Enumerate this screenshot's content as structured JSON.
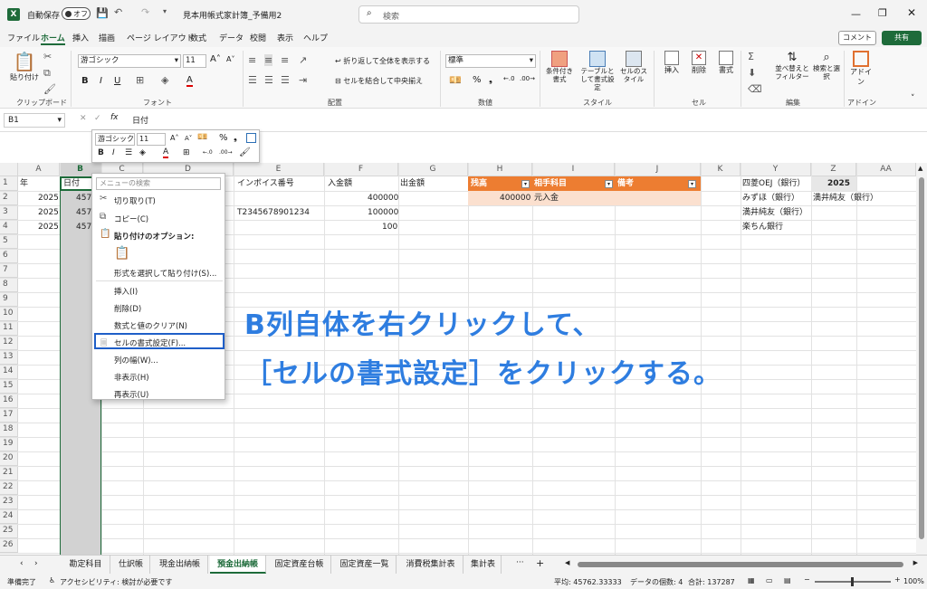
{
  "titlebar": {
    "autosave": "自動保存",
    "toggle": "オフ",
    "filename": "見本用帳式家計簿_予備用2",
    "search_placeholder": "検索"
  },
  "menu": [
    "ファイル",
    "ホーム",
    "挿入",
    "描画",
    "ページ レイアウト",
    "数式",
    "データ",
    "校閲",
    "表示",
    "ヘルプ"
  ],
  "menu_active_index": 1,
  "comment_label": "コメント",
  "share_label": "共有",
  "ribbon": {
    "paste": "貼り付け",
    "clipboard": "クリップボード",
    "font_name": "游ゴシック",
    "font_size": "11",
    "font_group": "フォント",
    "wrap": "折り返して全体を表示する",
    "merge": "セルを結合して中央揃え",
    "align_group": "配置",
    "number_format": "標準",
    "number_group": "数値",
    "cond_format": "条件付き書式",
    "table_format": "テーブルとして書式設定",
    "cell_style": "セルのスタイル",
    "style_group": "スタイル",
    "insert": "挿入",
    "delete": "削除",
    "format": "書式",
    "cells_group": "セル",
    "sort": "並べ替えとフィルター",
    "find": "検索と選択",
    "edit_group": "編集",
    "addin": "アドイン",
    "addin_group": "アドイン"
  },
  "formula": {
    "namebox": "B1",
    "value": "日付"
  },
  "columns": [
    "A",
    "B",
    "C",
    "D",
    "E",
    "F",
    "G",
    "H",
    "I",
    "J",
    "K",
    "Y",
    "Z",
    "AA"
  ],
  "rows": [
    "1",
    "2",
    "3",
    "4",
    "5",
    "6",
    "7",
    "8",
    "9",
    "10",
    "11",
    "12",
    "13",
    "14",
    "15",
    "16",
    "17",
    "18",
    "19",
    "20",
    "21",
    "22",
    "23",
    "24",
    "25",
    "26"
  ],
  "cells": {
    "a1": "年",
    "b1": "日付",
    "e1": "インボイス番号",
    "f1": "入金額",
    "g1": "出金額",
    "h1": "残高",
    "i1": "相手科目",
    "j1": "備考",
    "a2": "2025",
    "b2": "4574",
    "f2": "400000",
    "h2": "400000",
    "i2": "元入金",
    "a3": "2025",
    "b3": "4576",
    "e3": "T2345678901234",
    "f3": "100000",
    "a4": "2025",
    "b4": "457",
    "f4": "100",
    "y1": "四菱OEJ（銀行）",
    "z1": "2025",
    "y2": "みずほ（銀行）",
    "z2": "満井純友（銀行）",
    "y3": "満井純友（銀行）",
    "y4": "楽ちん銀行"
  },
  "mini_toolbar": {
    "font": "游ゴシック",
    "size": "11"
  },
  "context_menu": {
    "search_placeholder": "メニューの検索",
    "cut": "切り取り(T)",
    "copy": "コピー(C)",
    "paste_options": "貼り付けのオプション:",
    "paste_special": "形式を選択して貼り付け(S)...",
    "insert": "挿入(I)",
    "delete": "削除(D)",
    "clear": "数式と値のクリア(N)",
    "format_cells": "セルの書式設定(F)...",
    "col_width": "列の幅(W)...",
    "hide": "非表示(H)",
    "unhide": "再表示(U)"
  },
  "annotation": {
    "line1": "B列自体を右クリックして、",
    "line2": "［セルの書式設定］をクリックする。"
  },
  "sheet_tabs": [
    "勘定科目",
    "仕訳帳",
    "現金出納帳",
    "預金出納帳",
    "固定資産台帳",
    "固定資産一覧",
    "消費税集計表",
    "集計表"
  ],
  "active_sheet_index": 3,
  "status": {
    "ready": "準備完了",
    "accessibility": "アクセシビリティ: 検討が必要です",
    "average": "平均: 45762.33333",
    "count": "データの個数: 4",
    "sum": "合計: 137287",
    "zoom": "100%"
  },
  "colors": {
    "excel_green": "#1e6b3a",
    "header_orange": "#ed7d31",
    "light_orange": "#fbe0cf",
    "annotation_blue": "#2e7de0"
  }
}
